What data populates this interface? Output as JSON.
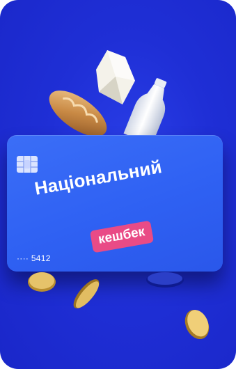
{
  "promo": {
    "title": "Національний",
    "badge": "кешбек",
    "card_number_masked": "···· 5412",
    "background_color": "#1f2fd6",
    "card_color": "#3063f3",
    "badge_color": "#e94b86"
  },
  "illustration": {
    "items": [
      "cheese",
      "bread-loaf",
      "milk-bottle",
      "gold-coin",
      "gold-coin",
      "gold-coin",
      "gold-coin",
      "blue-coin"
    ]
  }
}
